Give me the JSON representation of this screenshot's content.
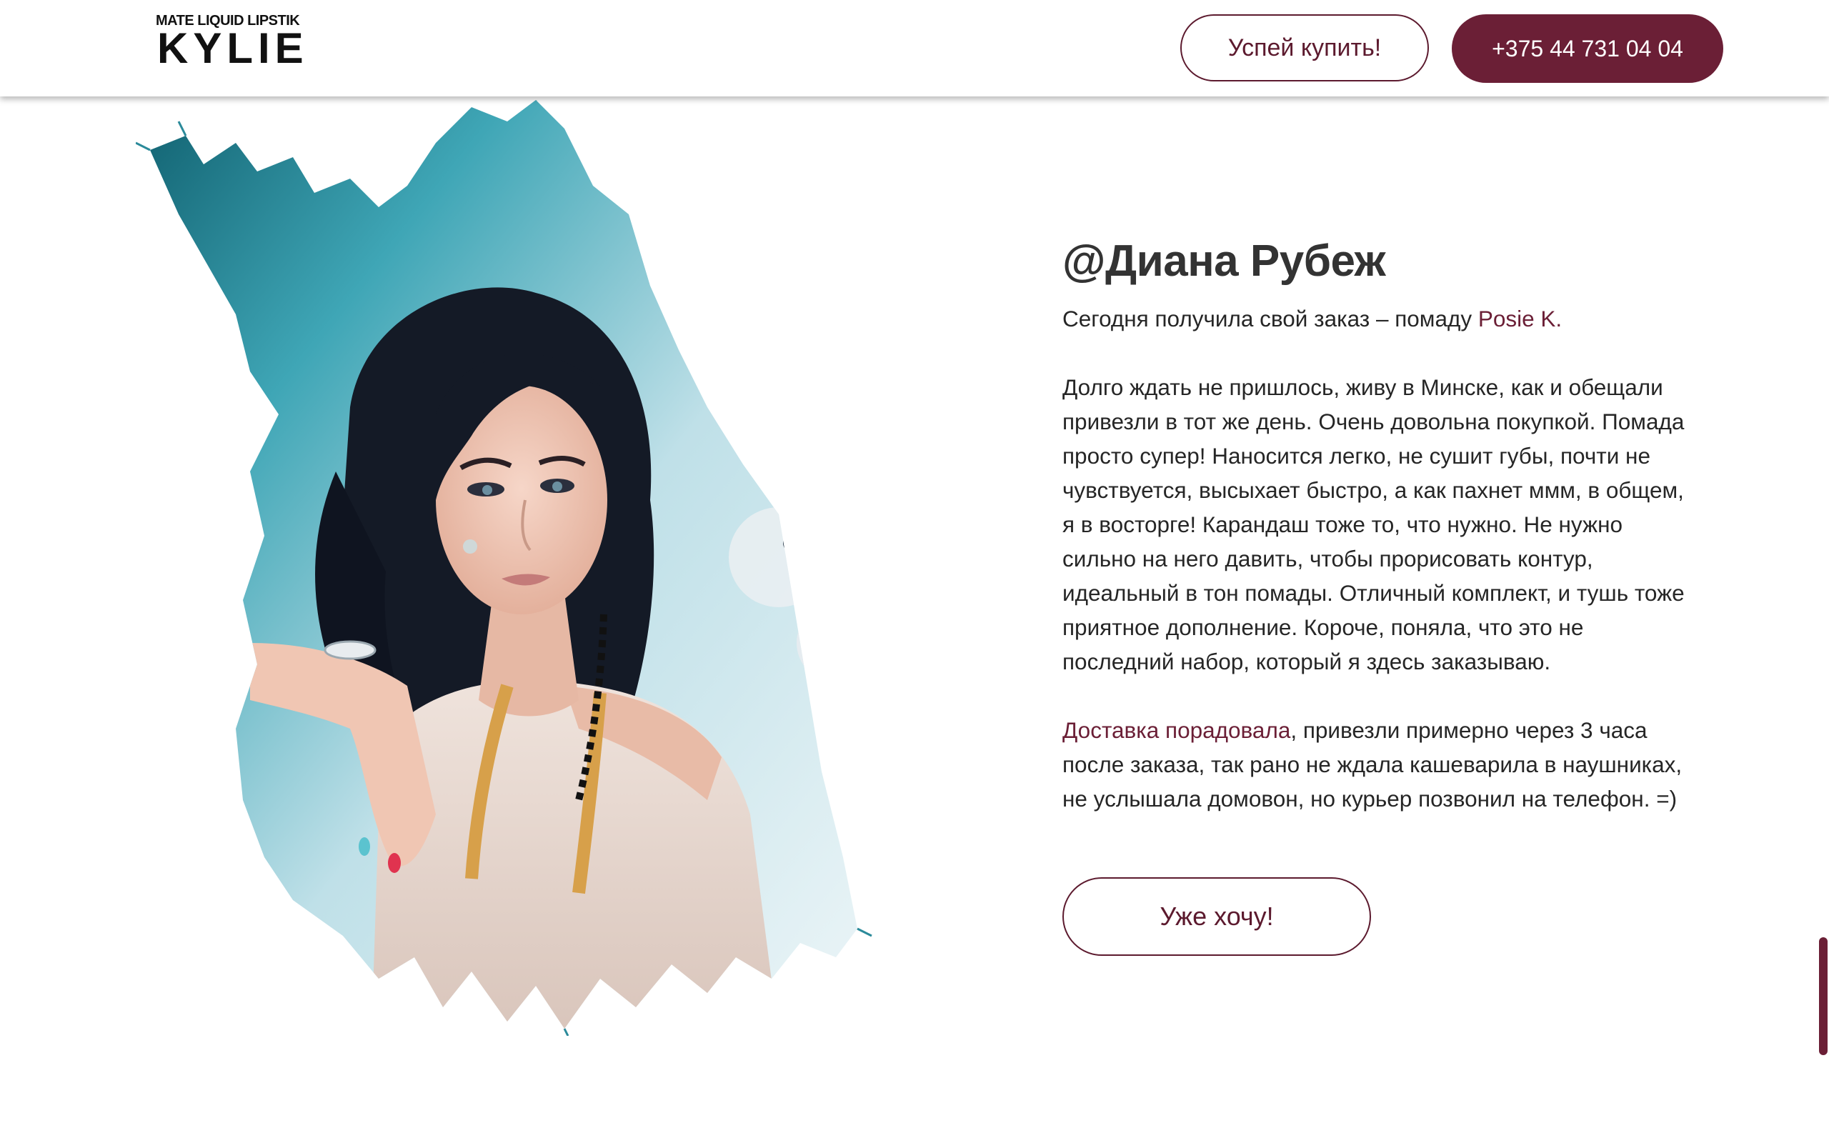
{
  "header": {
    "logo_subtitle": "MATE LIQUID LIPSTIK",
    "logo_title": "KYLIE",
    "hurry_button": "Успей купить!",
    "phone_button": "+375 44 731 04 04"
  },
  "review": {
    "author": "@Диана Рубеж",
    "intro_text": "Сегодня получила свой заказ – помаду ",
    "product_name": "Posie K.",
    "body_text": "Долго ждать не пришлось, живу в Минске, как и обещали привезли в тот же день. Очень довольна покупкой. Помада просто супер! Наносится легко, не сушит губы, почти не чувствуется, высыхает быстро, а как пахнет ммм, в общем, я в восторге! Карандаш тоже то, что нужно. Не нужно сильно на него давить, чтобы прорисовать контур, идеальный в тон помады. Отличный комплект, и тушь тоже приятное дополнение. Короче, поняла, что это не последний набор, который я здесь заказываю.",
    "delivery_highlight": "Доставка порадовала",
    "delivery_text": ", привезли примерно через 3 часа после заказа, так рано не ждала кашеварила в наушниках, не услышала домовон, но курьер позвонил на телефон. =)",
    "want_button": "Уже хочу!"
  },
  "colors": {
    "accent": "#6b1f36",
    "brand_outline": "#5c1a2e",
    "text": "#262626"
  }
}
